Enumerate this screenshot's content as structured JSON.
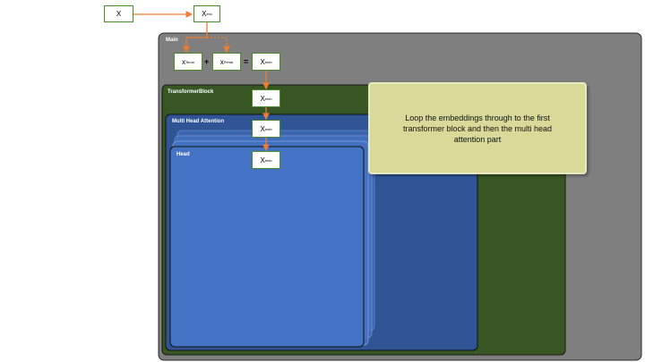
{
  "nodes": {
    "x": {
      "text": "X"
    },
    "x_enc": {
      "main": "X",
      "sub": "enc"
    },
    "x_temb": {
      "main": "x",
      "sub": "Temb"
    },
    "x_pemb": {
      "main": "x",
      "sub": "Pemb"
    },
    "x_emb_sum": {
      "main": "X",
      "sub": "emb"
    },
    "x_emb_block": {
      "main": "X",
      "sub": "emb"
    },
    "x_emb_mha": {
      "main": "X",
      "sub": "emb"
    },
    "x_emb_head": {
      "main": "X",
      "sub": "emb"
    }
  },
  "operators": {
    "plus": "+",
    "equals": "="
  },
  "regions": {
    "main": "Main",
    "transformer_block": "TransformerBlock",
    "multi_head_attention": "Multi Head Attention",
    "head": "Head"
  },
  "note": "Loop the embeddings through to the first transformer block and then the multi head attention part",
  "colors": {
    "main_bg": "#7f7f7f",
    "transformer_bg": "#375623",
    "mha_bg": "#2f5597",
    "head_bg": "#4472c4",
    "node_border": "#4a8a2a",
    "arrow": "#ed7d31",
    "note_bg": "#d9d99a"
  }
}
